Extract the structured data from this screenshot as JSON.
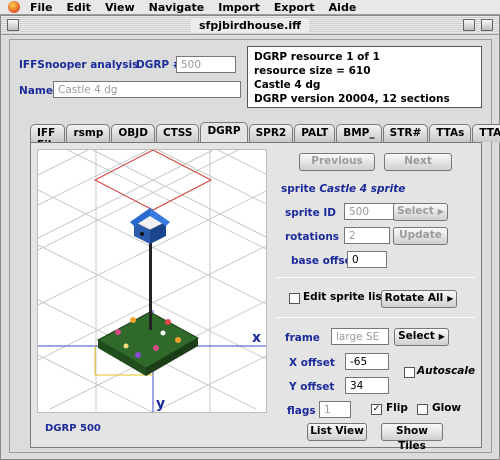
{
  "menubar": {
    "items": [
      "File",
      "Edit",
      "View",
      "Navigate",
      "Import",
      "Export",
      "Aide"
    ]
  },
  "window": {
    "title": "sfpjbirdhouse.iff"
  },
  "header": {
    "analysis_label": "IFFSnooper analysis",
    "dgrp_label": "DGRP #",
    "dgrp_value": "500",
    "name_label": "Name:",
    "name_value": "Castle 4 dg"
  },
  "info": {
    "lines": [
      "DGRP resource 1 of 1",
      "resource size =  610",
      "Castle 4 dg",
      "DGRP version 20004, 12 sections"
    ]
  },
  "tabs": [
    "IFF File",
    "rsmp",
    "OBJD",
    "CTSS",
    "DGRP",
    "SPR2",
    "PALT",
    "BMP_",
    "STR#",
    "TTAs",
    "TTAB"
  ],
  "active_tab": "DGRP",
  "viewport": {
    "axis_x_label": "x",
    "axis_y_label": "y",
    "dgrp_id": "DGRP 500"
  },
  "controls": {
    "previous": "Previous",
    "next": "Next",
    "sprite_label": "sprite",
    "sprite_name": "Castle 4 sprite",
    "sprite_id_label": "sprite ID",
    "sprite_id_value": "500",
    "select": "Select",
    "rotations_label": "rotations",
    "rotations_value": "2",
    "update": "Update",
    "base_offset_label": "base offset",
    "base_offset_value": "0",
    "edit_sprite_list": "Edit sprite list",
    "rotate_all": "Rotate All",
    "frame_label": "frame",
    "frame_value": "large SE",
    "x_offset_label": "X offset",
    "x_offset_value": "-65",
    "y_offset_label": "Y offset",
    "y_offset_value": "34",
    "autoscale": "Autoscale",
    "flags_label": "flags",
    "flags_value": "1",
    "flip": "Flip",
    "flip_checked": "✓",
    "glow": "Glow",
    "list_view": "List View",
    "show_tiles": "Show Tiles"
  }
}
